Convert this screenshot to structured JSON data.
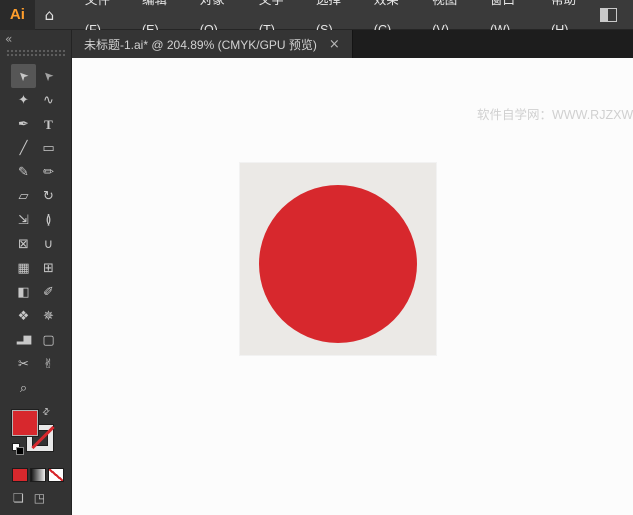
{
  "app": {
    "logo": "Ai",
    "home_icon": "⌂"
  },
  "menu_bar": {
    "items": [
      {
        "id": "file",
        "label": "文件(F)"
      },
      {
        "id": "edit",
        "label": "编辑(E)"
      },
      {
        "id": "object",
        "label": "对象(O)"
      },
      {
        "id": "type",
        "label": "文字(T)"
      },
      {
        "id": "select",
        "label": "选择(S)"
      },
      {
        "id": "effect",
        "label": "效果(C)"
      },
      {
        "id": "view",
        "label": "视图(V)"
      },
      {
        "id": "window",
        "label": "窗口(W)"
      },
      {
        "id": "help",
        "label": "帮助(H)"
      }
    ]
  },
  "document_tab": {
    "title": "未标题-1.ai* @ 204.89% (CMYK/GPU 预览)",
    "close_label": "×"
  },
  "toolbar": {
    "collapse_label": "«",
    "swap_icon": "⇄",
    "tools": [
      {
        "id": "selection",
        "glyph": "➤",
        "active": true
      },
      {
        "id": "direct-selection",
        "glyph": "➤"
      },
      {
        "id": "magic-wand",
        "glyph": "✦"
      },
      {
        "id": "lasso",
        "glyph": "∿"
      },
      {
        "id": "pen",
        "glyph": "✒"
      },
      {
        "id": "type",
        "glyph": "T"
      },
      {
        "id": "line-segment",
        "glyph": "╱"
      },
      {
        "id": "rectangle",
        "glyph": "▭"
      },
      {
        "id": "paintbrush",
        "glyph": "✎"
      },
      {
        "id": "pencil",
        "glyph": "✏"
      },
      {
        "id": "eraser",
        "glyph": "▱"
      },
      {
        "id": "rotate",
        "glyph": "↻"
      },
      {
        "id": "scale",
        "glyph": "⇲"
      },
      {
        "id": "width",
        "glyph": "≬"
      },
      {
        "id": "free-transform",
        "glyph": "⊠"
      },
      {
        "id": "shape-builder",
        "glyph": "∪"
      },
      {
        "id": "perspective-grid",
        "glyph": "▦"
      },
      {
        "id": "mesh",
        "glyph": "⊞"
      },
      {
        "id": "gradient",
        "glyph": "◧"
      },
      {
        "id": "eyedropper",
        "glyph": "✐"
      },
      {
        "id": "blend",
        "glyph": "❖"
      },
      {
        "id": "symbol-sprayer",
        "glyph": "✵"
      },
      {
        "id": "column-graph",
        "glyph": "▂▆"
      },
      {
        "id": "artboard",
        "glyph": "▢"
      },
      {
        "id": "slice",
        "glyph": "✂"
      },
      {
        "id": "hand",
        "glyph": "✌"
      },
      {
        "id": "zoom",
        "glyph": "⌕"
      }
    ],
    "fill_color": "#d7282d",
    "stroke": "none",
    "draw_mode_icon": "❏",
    "screen_mode_icon": "◳"
  },
  "canvas": {
    "background": "#fcfcfc",
    "watermark": "软件自学网：WWW.RJZXW",
    "artboard_color": "#ebe9e6",
    "circle_color": "#d7282d"
  }
}
